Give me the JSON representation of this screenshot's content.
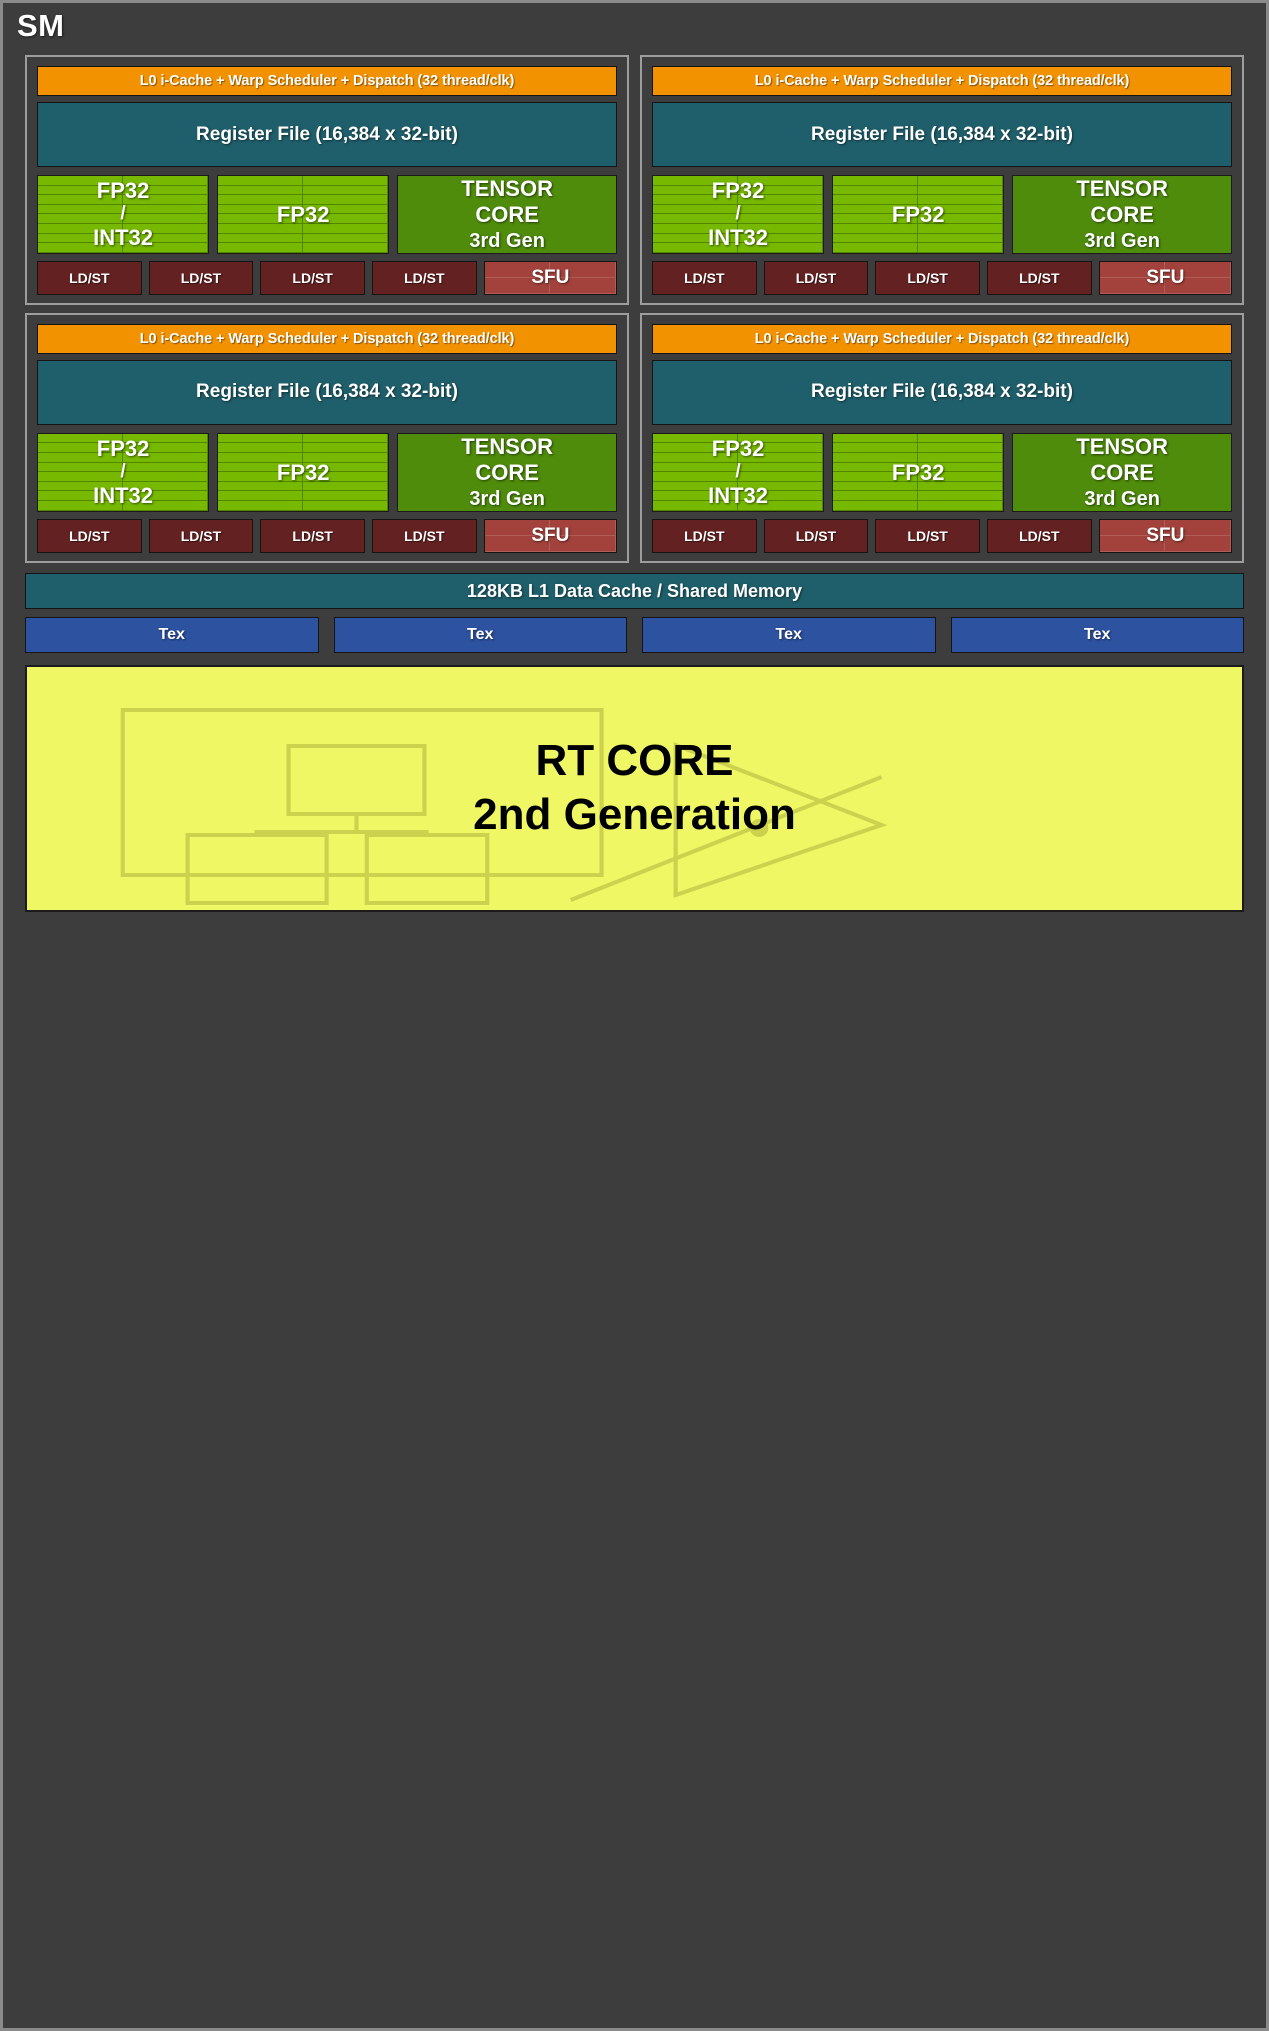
{
  "sm": {
    "title": "SM",
    "colors": {
      "background": "#3d3d3d",
      "border": "#8a8a8a",
      "scheduler_orange": "#f39200",
      "register_teal": "#1f5f6b",
      "fp32_green": "#76b900",
      "tensor_green": "#4f8c0b",
      "ldst_dark_red": "#642121",
      "sfu_red": "#a3423c",
      "tex_blue": "#2d52a0",
      "rt_yellow": "#eff764"
    }
  },
  "partitions": [
    {
      "id": "partition-0",
      "scheduler": "L0 i-Cache + Warp Scheduler + Dispatch (32 thread/clk)",
      "register_file": "Register File (16,384 x 32-bit)",
      "fp32_a": {
        "line1": "FP32",
        "slash": "/",
        "line2": "INT32"
      },
      "fp32_b": {
        "line1": "FP32"
      },
      "tensor": {
        "line1": "TENSOR",
        "line2": "CORE",
        "line3": "3rd Gen"
      },
      "ldst": [
        "LD/ST",
        "LD/ST",
        "LD/ST",
        "LD/ST"
      ],
      "sfu": "SFU"
    },
    {
      "id": "partition-1",
      "scheduler": "L0 i-Cache + Warp Scheduler + Dispatch (32 thread/clk)",
      "register_file": "Register File (16,384 x 32-bit)",
      "fp32_a": {
        "line1": "FP32",
        "slash": "/",
        "line2": "INT32"
      },
      "fp32_b": {
        "line1": "FP32"
      },
      "tensor": {
        "line1": "TENSOR",
        "line2": "CORE",
        "line3": "3rd Gen"
      },
      "ldst": [
        "LD/ST",
        "LD/ST",
        "LD/ST",
        "LD/ST"
      ],
      "sfu": "SFU"
    },
    {
      "id": "partition-2",
      "scheduler": "L0 i-Cache + Warp Scheduler + Dispatch (32 thread/clk)",
      "register_file": "Register File (16,384 x 32-bit)",
      "fp32_a": {
        "line1": "FP32",
        "slash": "/",
        "line2": "INT32"
      },
      "fp32_b": {
        "line1": "FP32"
      },
      "tensor": {
        "line1": "TENSOR",
        "line2": "CORE",
        "line3": "3rd Gen"
      },
      "ldst": [
        "LD/ST",
        "LD/ST",
        "LD/ST",
        "LD/ST"
      ],
      "sfu": "SFU"
    },
    {
      "id": "partition-3",
      "scheduler": "L0 i-Cache + Warp Scheduler + Dispatch (32 thread/clk)",
      "register_file": "Register File (16,384 x 32-bit)",
      "fp32_a": {
        "line1": "FP32",
        "slash": "/",
        "line2": "INT32"
      },
      "fp32_b": {
        "line1": "FP32"
      },
      "tensor": {
        "line1": "TENSOR",
        "line2": "CORE",
        "line3": "3rd Gen"
      },
      "ldst": [
        "LD/ST",
        "LD/ST",
        "LD/ST",
        "LD/ST"
      ],
      "sfu": "SFU"
    }
  ],
  "l1_cache": {
    "label": "128KB L1 Data Cache / Shared Memory"
  },
  "tex_units": [
    {
      "label": "Tex"
    },
    {
      "label": "Tex"
    },
    {
      "label": "Tex"
    },
    {
      "label": "Tex"
    }
  ],
  "rt_core": {
    "line1": "RT CORE",
    "line2": "2nd Generation",
    "graphics": [
      "bvh-tree-icon",
      "ray-triangle-intersection-icon"
    ]
  }
}
